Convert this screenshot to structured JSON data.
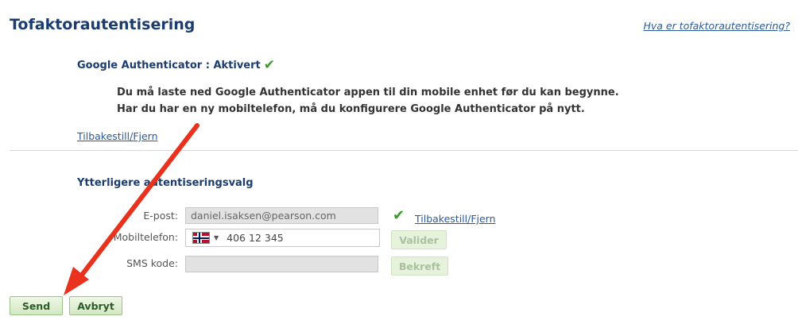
{
  "header": {
    "title": "Tofaktorautentisering",
    "help_link": "Hva er tofaktorautentisering?"
  },
  "google_auth": {
    "heading": "Google Authenticator : Aktivert",
    "info_line1": "Du må laste ned Google Authenticator appen til din mobile enhet før du kan begynne.",
    "info_line2": "Har du har en ny mobiltelefon, må du konfigurere Google Authenticator på nytt.",
    "reset_link": "Tilbakestill/Fjern"
  },
  "extra": {
    "heading": "Ytterligere autentiseringsvalg",
    "email_label": "E-post:",
    "email_value": "daniel.isaksen@pearson.com",
    "email_reset_link": "Tilbakestill/Fjern",
    "phone_label": "Mobiltelefon:",
    "phone_value": "406 12 345",
    "phone_country": "Norway",
    "validate_button": "Valider",
    "sms_label": "SMS kode:",
    "sms_value": "",
    "confirm_button": "Bekreft"
  },
  "actions": {
    "send_button": "Send",
    "cancel_button": "Avbryt"
  },
  "icons": {
    "status_check": "check-icon",
    "flag": "norway-flag-icon",
    "dropdown": "caret-down-icon",
    "annotation": "red-arrow-annotation"
  },
  "colors": {
    "heading": "#1b3c6e",
    "link": "#2a5a9a",
    "check": "#3a9a2a",
    "button_bg": "#d2e8c2",
    "annotation_arrow": "#e8321e"
  }
}
